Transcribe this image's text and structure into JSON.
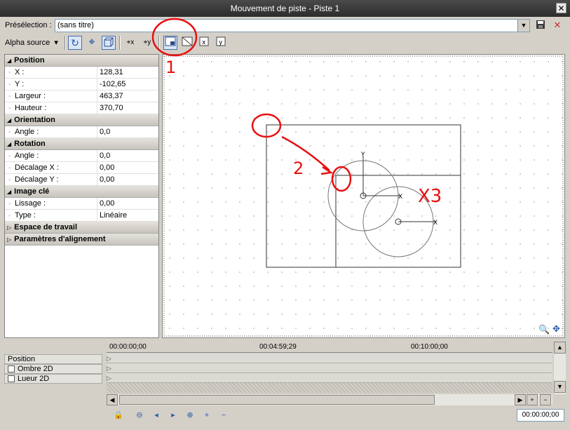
{
  "window": {
    "title": "Mouvement de piste - Piste 1",
    "close_glyph": "✕"
  },
  "preset": {
    "label": "Présélection :",
    "value": "(sans titre)"
  },
  "toolbar": {
    "alpha_label": "Alpha source"
  },
  "properties": {
    "position": {
      "title": "Position",
      "rows": [
        {
          "key": "X :",
          "value": "128,31"
        },
        {
          "key": "Y :",
          "value": "-102,65"
        },
        {
          "key": "Largeur :",
          "value": "463,37"
        },
        {
          "key": "Hauteur :",
          "value": "370,70"
        }
      ]
    },
    "orientation": {
      "title": "Orientation",
      "rows": [
        {
          "key": "Angle :",
          "value": "0,0"
        }
      ]
    },
    "rotation": {
      "title": "Rotation",
      "rows": [
        {
          "key": "Angle :",
          "value": "0,0"
        },
        {
          "key": "Décalage X :",
          "value": "0,00"
        },
        {
          "key": "Décalage Y :",
          "value": "0,00"
        }
      ]
    },
    "keyframe": {
      "title": "Image clé",
      "rows": [
        {
          "key": "Lissage :",
          "value": "0,00"
        },
        {
          "key": "Type :",
          "value": "Linéaire"
        }
      ]
    },
    "workspace": {
      "title": "Espace de travail"
    },
    "alignment": {
      "title": "Paramètres d'alignement"
    }
  },
  "canvas": {
    "annotations": {
      "n1": "1",
      "n2": "2",
      "n3": "X3"
    },
    "axis_x": "X",
    "axis_y": "Y"
  },
  "timeline": {
    "tracks": [
      {
        "label": "Position",
        "checkbox": false
      },
      {
        "label": "Ombre 2D",
        "checkbox": true
      },
      {
        "label": "Lueur 2D",
        "checkbox": true
      }
    ],
    "ruler": [
      "00:00:00;00",
      "00:04:59;29",
      "00:10:00;00"
    ],
    "timecode": "00:00:00;00"
  },
  "colors": {
    "annotation": "#e81010",
    "selection": "#4a6da8"
  }
}
